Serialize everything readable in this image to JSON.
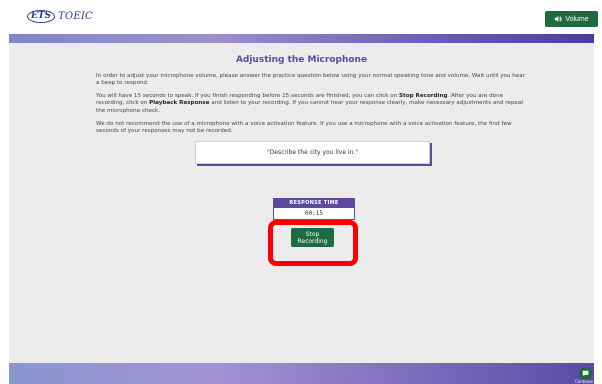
{
  "header": {
    "logo_ets": "ETS",
    "logo_toeic": "TOEIC",
    "volume_label": "Volume"
  },
  "main": {
    "title": "Adjusting the Microphone",
    "paragraph1": "In order to adjust your microphone volume, please answer the practice question below using your normal speaking tone and volume. Wait until you hear a beep to respond.",
    "paragraph2_part1": "You will have 15 seconds to speak. If you finish responding before 15 seconds are finished, you can click on ",
    "paragraph2_bold1": "Stop Recording",
    "paragraph2_part2": ". After you are done recording, click on ",
    "paragraph2_bold2": "Playback Response",
    "paragraph2_part3": " and listen to your recording. If you cannot hear your response clearly, make necessary adjustments and repeat the microphone check.",
    "paragraph3": "We do not recommend the use of a microphone with a voice activation feature. If you use a microphone with a voice activation feature, the first few seconds of your responses may not be recorded.",
    "question": "\"Describe the city you live in.\""
  },
  "response": {
    "header": "RESPONSE TIME",
    "time": "00:15"
  },
  "controls": {
    "stop_recording": "Stop\nRecording",
    "corner_label": "Continue"
  },
  "colors": {
    "accent_purple": "#5b4aa0",
    "button_green": "#1f6b3f",
    "highlight_red": "#ff0000"
  },
  "icons": {
    "volume": "speaker-icon",
    "corner": "chat-icon"
  }
}
